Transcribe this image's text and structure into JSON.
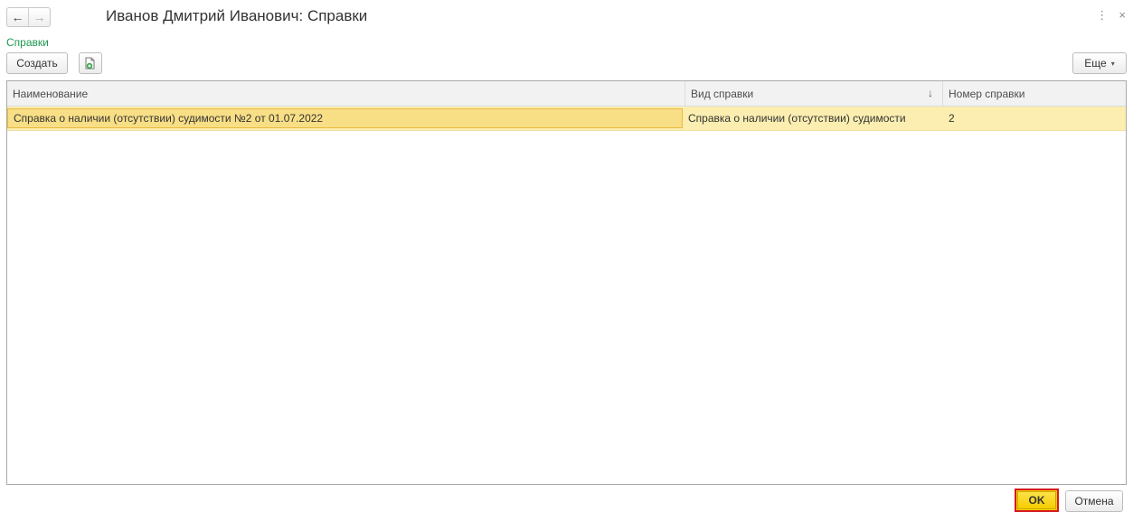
{
  "titlebar": {
    "back_icon": "←",
    "forward_icon": "→",
    "title": "Иванов Дмитрий Иванович: Справки",
    "menu_icon": "⋮",
    "close_icon": "×"
  },
  "section": {
    "link_label": "Справки"
  },
  "toolbar": {
    "create_label": "Создать",
    "copy_icon": "copy-document-icon",
    "more_label": "Еще",
    "more_caret": "▾"
  },
  "table": {
    "columns": [
      {
        "label": "Наименование"
      },
      {
        "label": "Вид справки",
        "sort_icon": "↓"
      },
      {
        "label": "Номер справки"
      }
    ],
    "rows": [
      {
        "name": "Справка о наличии (отсутствии) судимости №2 от 01.07.2022",
        "type": "Справка о наличии (отсутствии) судимости",
        "number": "2"
      }
    ]
  },
  "footer": {
    "ok_label": "OK",
    "cancel_label": "Отмена"
  },
  "colors": {
    "accent_green": "#1c9850",
    "selection_row": "#fbeeb0",
    "selection_cell": "#f8df86",
    "ok_button": "#f9d200",
    "highlight_frame": "#d7171e"
  }
}
